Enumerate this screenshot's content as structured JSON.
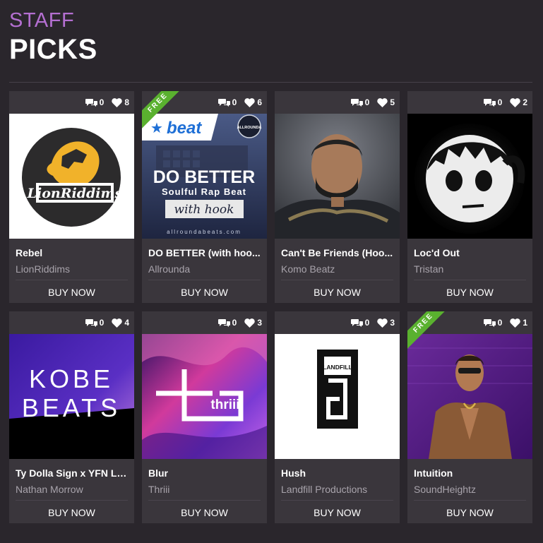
{
  "header": {
    "kicker": "STAFF",
    "title": "PICKS"
  },
  "cards": [
    {
      "comments": "0",
      "likes": "8",
      "title": "Rebel",
      "artist": "LionRiddims",
      "buy_label": "BUY NOW",
      "free": false
    },
    {
      "comments": "0",
      "likes": "6",
      "title": "DO BETTER (with hoo...",
      "artist": "Allrounda",
      "buy_label": "BUY NOW",
      "free": true,
      "free_label": "FREE",
      "cover_text": {
        "brand": "beat",
        "line1": "DO BETTER",
        "line2": "Soulful Rap Beat",
        "line3": "with hook",
        "site": "allroundabeats.com",
        "logo": "ALLROUNDA"
      }
    },
    {
      "comments": "0",
      "likes": "5",
      "title": "Can't Be Friends (Hoo...",
      "artist": "Komo Beatz",
      "buy_label": "BUY NOW",
      "free": false
    },
    {
      "comments": "0",
      "likes": "2",
      "title": "Loc'd Out",
      "artist": "Tristan",
      "buy_label": "BUY NOW",
      "free": false
    },
    {
      "comments": "0",
      "likes": "4",
      "title": "Ty Dolla Sign x YFN Lu...",
      "artist": "Nathan Morrow",
      "buy_label": "BUY NOW",
      "free": false,
      "cover_text": {
        "line1": "KOBE",
        "line2": "BEATS"
      }
    },
    {
      "comments": "0",
      "likes": "3",
      "title": "Blur",
      "artist": "Thriii",
      "buy_label": "BUY NOW",
      "free": false,
      "cover_text": {
        "brand": "thriii"
      }
    },
    {
      "comments": "0",
      "likes": "3",
      "title": "Hush",
      "artist": "Landfill Productions",
      "buy_label": "BUY NOW",
      "free": false,
      "cover_text": {
        "brand": "LANDFILL"
      }
    },
    {
      "comments": "0",
      "likes": "1",
      "title": "Intuition",
      "artist": "SoundHeightz",
      "buy_label": "BUY NOW",
      "free": true,
      "free_label": "FREE"
    }
  ],
  "colors": {
    "accent": "#b46fd1",
    "background": "#2a262c",
    "card": "#3a363c",
    "free_badge": "#5ab12f"
  },
  "icons": {
    "comments": "speech-bubbles-icon",
    "likes": "heart-icon"
  }
}
